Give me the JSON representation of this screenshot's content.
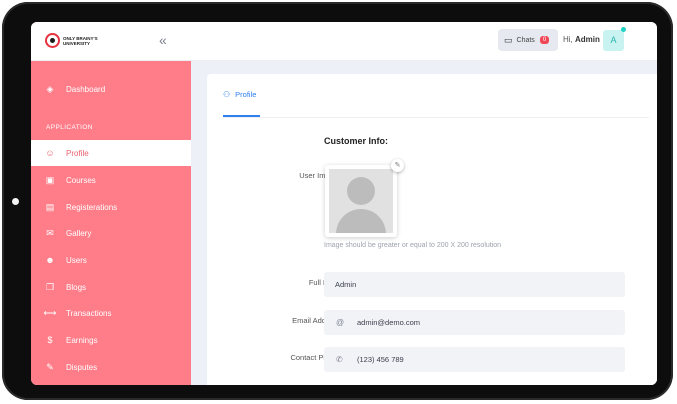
{
  "sidebar": {
    "logo_text": "ONLY BRAINY'S UNIVERSITY",
    "section_label": "APPLICATION",
    "items": [
      {
        "label": "Dashboard",
        "icon": "layers-icon"
      },
      {
        "label": "Profile",
        "icon": "profile-icon"
      },
      {
        "label": "Courses",
        "icon": "courses-icon"
      },
      {
        "label": "Registerations",
        "icon": "registration-icon"
      },
      {
        "label": "Gallery",
        "icon": "gallery-icon"
      },
      {
        "label": "Users",
        "icon": "users-icon"
      },
      {
        "label": "Blogs",
        "icon": "blogs-icon"
      },
      {
        "label": "Transactions",
        "icon": "transactions-icon"
      },
      {
        "label": "Earnings",
        "icon": "dollar-icon"
      },
      {
        "label": "Disputes",
        "icon": "disputes-icon"
      }
    ]
  },
  "header": {
    "chats_label": "Chats",
    "chats_count": "0",
    "greeting_prefix": "Hi,",
    "user_name": "Admin",
    "avatar_initial": "A"
  },
  "main": {
    "tab_label": "Profile",
    "section_title": "Customer Info:",
    "user_image_label": "User Image",
    "image_hint": "Image should be greater or equal to 200 X 200 resolution",
    "full_name_label": "Full Name",
    "full_name_value": "Admin",
    "email_label": "Email Address",
    "email_value": "admin@demo.com",
    "phone_label": "Contact Phone",
    "phone_value": "(123) 456 789"
  },
  "colors": {
    "sidebar": "#fe7d89",
    "accent": "#2f80ed",
    "badge": "#f04758"
  }
}
